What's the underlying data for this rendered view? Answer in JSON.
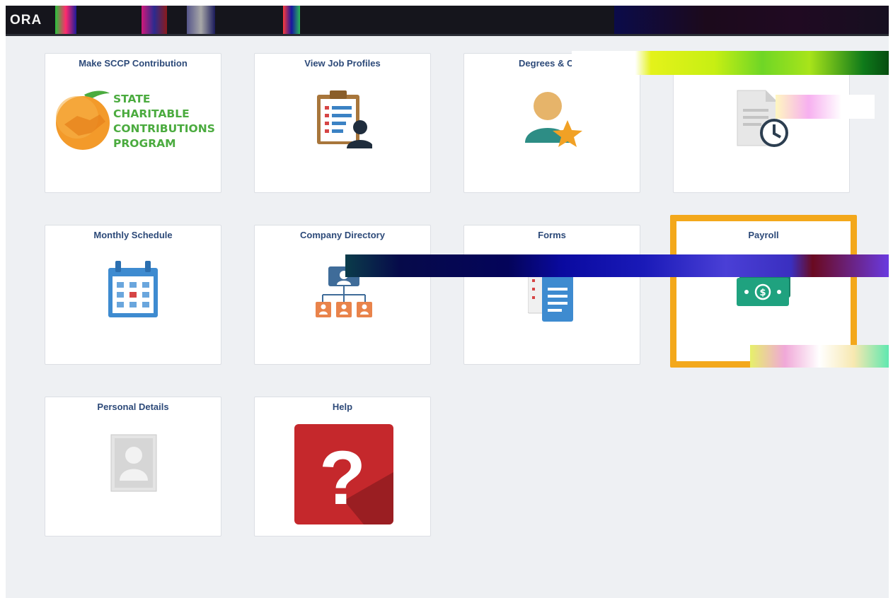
{
  "banner": {
    "logo_text": "ORA"
  },
  "tiles": [
    {
      "title": "Make SCCP Contribution",
      "icon": "orange-handshake-logo",
      "logo_lines": [
        "STATE",
        "CHARITABLE",
        "CONTRIBUTIONS",
        "PROGRAM"
      ]
    },
    {
      "title": "View Job Profiles",
      "icon": "clipboard-person-icon"
    },
    {
      "title": "Degrees & Cert",
      "icon": "person-star-icon"
    },
    {
      "title": "",
      "icon": "document-clock-icon"
    },
    {
      "title": "Monthly Schedule",
      "icon": "calendar-icon"
    },
    {
      "title": "Company Directory",
      "icon": "org-chart-icon"
    },
    {
      "title": "Forms",
      "icon": "form-document-icon"
    },
    {
      "title": "Payroll",
      "icon": "money-bill-icon",
      "selected": true
    },
    {
      "title": "Personal Details",
      "icon": "avatar-placeholder-icon"
    },
    {
      "title": "Help",
      "icon": "help-question-icon"
    }
  ],
  "colors": {
    "banner": "#15151c",
    "page_bg": "#eef0f3",
    "tile_title": "#2d4a79",
    "selected_border": "#f3a81b",
    "sccp_green": "#4bab3f",
    "help_red": "#c5282c",
    "money_green": "#1fa27f"
  }
}
